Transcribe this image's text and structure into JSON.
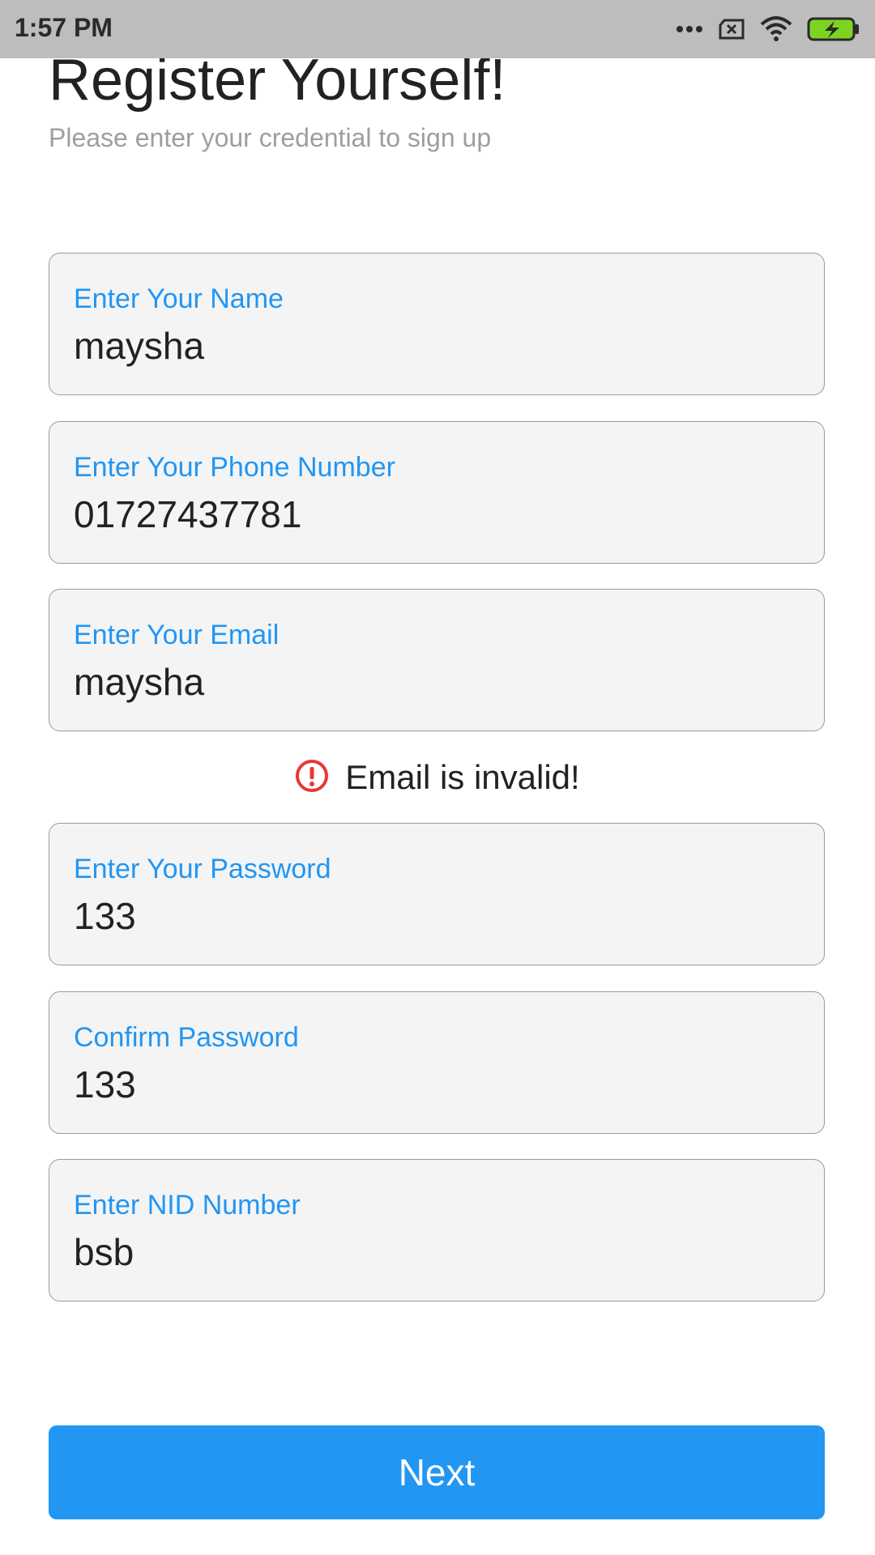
{
  "status_bar": {
    "time": "1:57 PM",
    "icons": [
      "more-dots-icon",
      "sim-x-icon",
      "wifi-icon",
      "battery-charging-icon"
    ]
  },
  "header": {
    "title": "Register Yourself!",
    "subtitle": "Please enter your credential to sign up"
  },
  "form": {
    "name": {
      "label": "Enter Your Name",
      "value": "maysha"
    },
    "phone": {
      "label": "Enter Your Phone Number",
      "value": "01727437781"
    },
    "email": {
      "label": "Enter Your Email",
      "value": "maysha"
    },
    "email_error": {
      "icon": "error-circle-icon",
      "text": "Email is invalid!"
    },
    "password": {
      "label": "Enter Your Password",
      "value": "133"
    },
    "confirm_password": {
      "label": "Confirm Password",
      "value": "133"
    },
    "nid": {
      "label": "Enter NID Number",
      "value": "bsb"
    }
  },
  "actions": {
    "next_label": "Next"
  },
  "colors": {
    "accent": "#2196f3",
    "error": "#e53935",
    "status_bar": "#bdbdbd",
    "field_bg": "#f4f4f4"
  }
}
